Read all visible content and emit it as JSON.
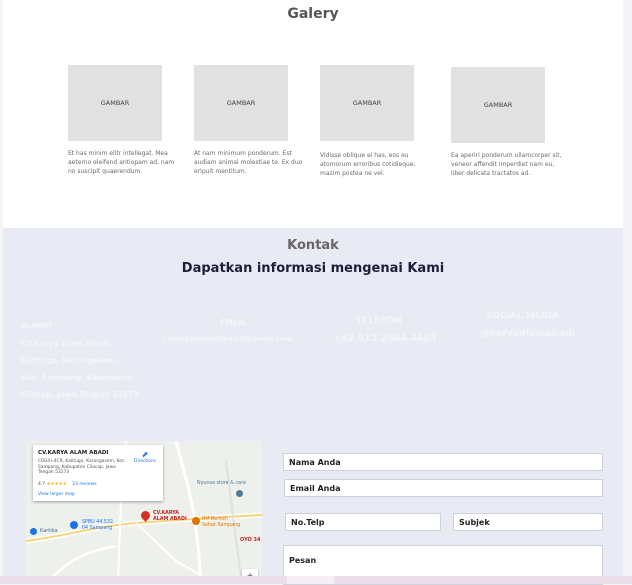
{
  "gallery": {
    "title": "Galery",
    "items": [
      {
        "label": "GAMBAR",
        "caption": "Et has minim elitr intellegat. Mea aeterno eleifend antiopam ad, nam no suscipit quaerendum."
      },
      {
        "label": "GAMBAR",
        "caption": "At nam minimum ponderum. Est audiam animal molestiae te. Ex duo eripuit mentitum."
      },
      {
        "label": "GAMBAR",
        "caption": "Vidisse oblique ei has, eos eu atomorum erroribus cotidieque, mazim postea ne vel."
      },
      {
        "label": "GAMBAR",
        "caption": "Ea aperiri ponderum ullamcorper sit, veneor affendit imperdiet nam eu, liber delicata tractatos ad."
      }
    ]
  },
  "kontak": {
    "title": "Kontak",
    "subtitle": "Dapatkan informasi mengenai Kami",
    "alamat_label": "ALAMAT",
    "alamat_lines": [
      "CV.Karya Alam Abadi,",
      "Kalitugu, Karangasem,",
      "Kec. Sampang, Kabupaten",
      "Cilacap, Jawa Tengah 53273"
    ],
    "email_label": "EMAIL",
    "email_value": "cvkaryaalamabadi10@gmail.com",
    "telepon_label": "TELEPON",
    "telepon_value": "+62 812 2944 4485",
    "social_label": "SOCIAL MEDIA",
    "social_value": "@karyaalamabadi"
  },
  "map": {
    "place_name": "CV.KARYA ALAM ABADI",
    "address": "C6G4+4CR, Kalitugu, Karangasem, Kec. Sampang, Kabupaten Cilacap, Jawa Tengah 53273",
    "rating": "4.7",
    "stars": "★★★★★",
    "reviews": "23 reviews",
    "directions": "Directions",
    "view_larger": "View larger map",
    "pin_label_1": "CV.KARYA",
    "pin_label_2": "ALAM ABADI",
    "spbu_label_1": "SPBU 44.532.",
    "spbu_label_2": "04 Sampang",
    "rm_label_1": "RM Berkah",
    "rm_label_2": "Sehat Sampang",
    "store_label": "Nyunsa store & care",
    "kartika_label": "Kartika",
    "oyo_label": "OYO 34",
    "zoom_plus": "+"
  },
  "form": {
    "nama": "Nama Anda",
    "email": "Email Anda",
    "telp": "No.Telp",
    "subjek": "Subjek",
    "pesan": "Pesan"
  },
  "colors": {
    "gallery_bg": "#ffffff",
    "kontak_bg": "#e8eaf4",
    "placeholder_gray": "#e1e1e1",
    "pin_red": "#d93025"
  }
}
